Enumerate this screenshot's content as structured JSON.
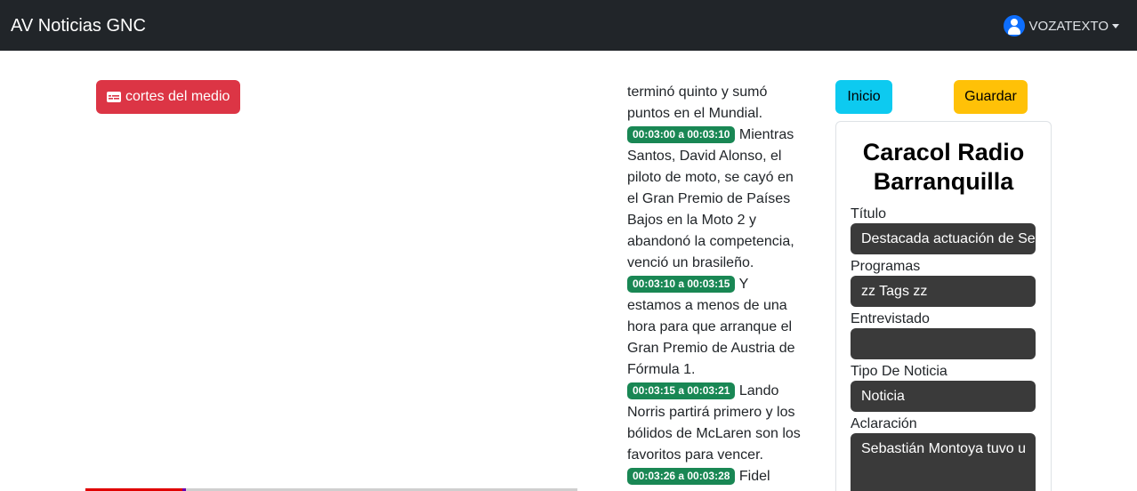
{
  "navbar": {
    "brand": "AV Noticias GNC",
    "user": "VOZATEXTO",
    "user_icon": "person-circle-icon"
  },
  "toolbar": {
    "cortes_label": "cortes del medio",
    "cortes_icon": "subtitles-icon",
    "inicio_label": "Inicio",
    "guardar_label": "Guardar"
  },
  "player": {
    "progress_fraction": 0.2
  },
  "transcript": {
    "intro": "terminó quinto y sumó puntos en el Mundial.",
    "segments": [
      {
        "time": "00:03:00 a 00:03:10",
        "text": "Mientras Santos, David Alonso, el piloto de moto, se cayó en el Gran Premio de Países Bajos en la Moto 2 y abandonó la competencia, venció un brasileño."
      },
      {
        "time": "00:03:10 a 00:03:15",
        "text": "Y estamos a menos de una hora para que arranque el Gran Premio de Austria de Fórmula 1."
      },
      {
        "time": "00:03:15 a 00:03:21",
        "text": "Lando Norris partirá primero y los bólidos de McLaren son los favoritos para vencer."
      },
      {
        "time": "00:03:26 a 00:03:28",
        "text": "Fidel"
      }
    ]
  },
  "card": {
    "station": "Caracol Radio Barranquilla",
    "titulo_label": "Título",
    "titulo_value": "Destacada actuación de Se",
    "programas_label": "Programas",
    "programas_value": "zz Tags zz",
    "entrevistado_label": "Entrevistado",
    "entrevistado_value": "",
    "tipo_label": "Tipo De Noticia",
    "tipo_value": "Noticia",
    "aclaracion_label": "Aclaración",
    "aclaracion_value": "Sebastián Montoya tuvo u"
  },
  "colors": {
    "navbar": "#212529",
    "danger": "#dc3545",
    "info": "#0dcaf0",
    "warning": "#ffc107",
    "timestamp": "#198754",
    "field": "#3a3a3a"
  }
}
